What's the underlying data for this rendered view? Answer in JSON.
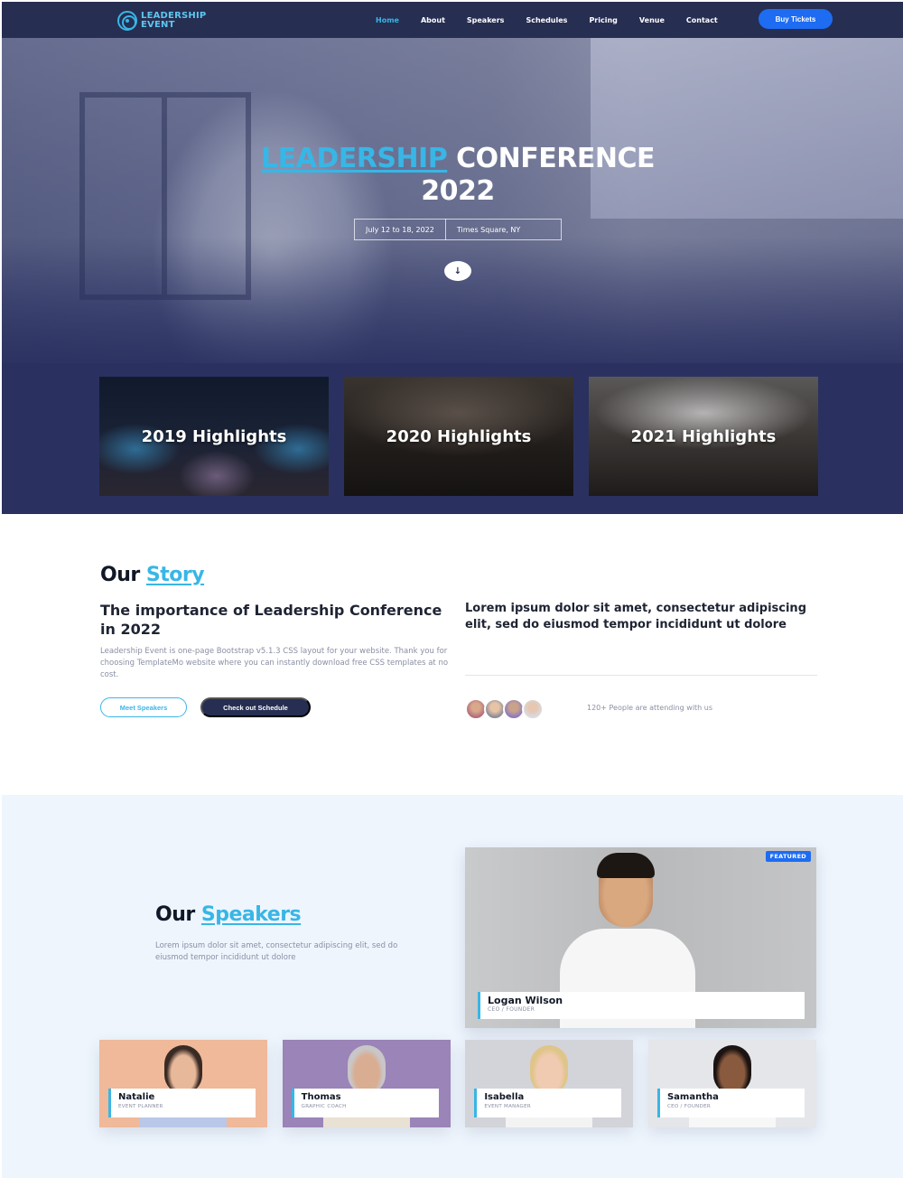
{
  "nav": {
    "brand": "LEADERSHIP EVENT",
    "links": [
      "Home",
      "About",
      "Speakers",
      "Schedules",
      "Pricing",
      "Venue",
      "Contact"
    ],
    "active": "Home",
    "cta": "Buy Tickets"
  },
  "hero": {
    "title_accent": "LEADERSHIP",
    "title_rest": "CONFERENCE",
    "title_year": "2022",
    "date": "July 12 to 18, 2022",
    "location": "Times Square, NY",
    "scroll_icon": "arrow-down-icon",
    "highlights": [
      "2019 Highlights",
      "2020 Highlights",
      "2021 Highlights"
    ]
  },
  "story": {
    "title_plain": "Our",
    "title_accent": "Story",
    "subtitle": "The importance of Leadership Conference in 2022",
    "description": "Leadership Event is one-page Bootstrap v5.1.3 CSS layout for your website. Thank you for choosing TemplateMo website where you can instantly download free CSS templates at no cost.",
    "btn_meet": "Meet Speakers",
    "btn_schedule": "Check out Schedule",
    "quote": "Lorem ipsum dolor sit amet, consectetur adipiscing elit, sed do eiusmod tempor incididunt ut dolore",
    "attending": "120+ People are attending with us"
  },
  "speakers": {
    "title_plain": "Our",
    "title_accent": "Speakers",
    "description": "Lorem ipsum dolor sit amet, consectetur adipiscing elit, sed do eiusmod tempor incididunt ut dolore",
    "featured": {
      "badge": "FEATURED",
      "name": "Logan Wilson",
      "role": "CEO / FOUNDER"
    },
    "list": [
      {
        "name": "Natalie",
        "role": "EVENT PLANNER"
      },
      {
        "name": "Thomas",
        "role": "GRAPHIC COACH"
      },
      {
        "name": "Isabella",
        "role": "EVENT MANAGER"
      },
      {
        "name": "Samantha",
        "role": "CEO / FOUNDER"
      }
    ]
  },
  "colors": {
    "navy": "#262e52",
    "accent": "#38b6e6",
    "primary_button": "#1d6cf2",
    "speakers_bg": "#eef5fd"
  }
}
